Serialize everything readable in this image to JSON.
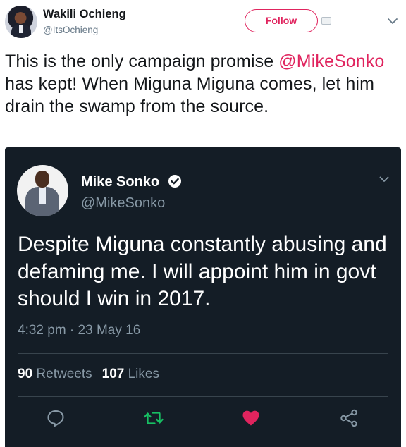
{
  "tweet": {
    "author_name": "Wakili Ochieng",
    "author_handle": "@ItsOchieng",
    "follow_label": "Follow",
    "text_before_mention": "This is the only campaign promise ",
    "mention": "@MikeSonko",
    "text_after_mention": " has kept! When Miguna Miguna comes, let him drain the swamp from the source."
  },
  "quoted": {
    "author_name": "Mike Sonko",
    "author_handle": "@MikeSonko",
    "text": "Despite Miguna constantly abusing and defaming me. I will appoint him in govt should I win in 2017.",
    "timestamp": "4:32 pm · 23 May 16",
    "retweets_count": "90",
    "retweets_label": "Retweets",
    "likes_count": "107",
    "likes_label": "Likes"
  },
  "icons": {
    "verified": "verified-badge-icon",
    "reply": "reply-icon",
    "retweet": "retweet-icon",
    "like": "heart-icon",
    "share": "share-icon",
    "more": "chevron-down-icon"
  },
  "colors": {
    "accent": "#e0245e",
    "retweet": "#17bf63",
    "card_bg": "#141d26",
    "muted": "#8899a6"
  }
}
